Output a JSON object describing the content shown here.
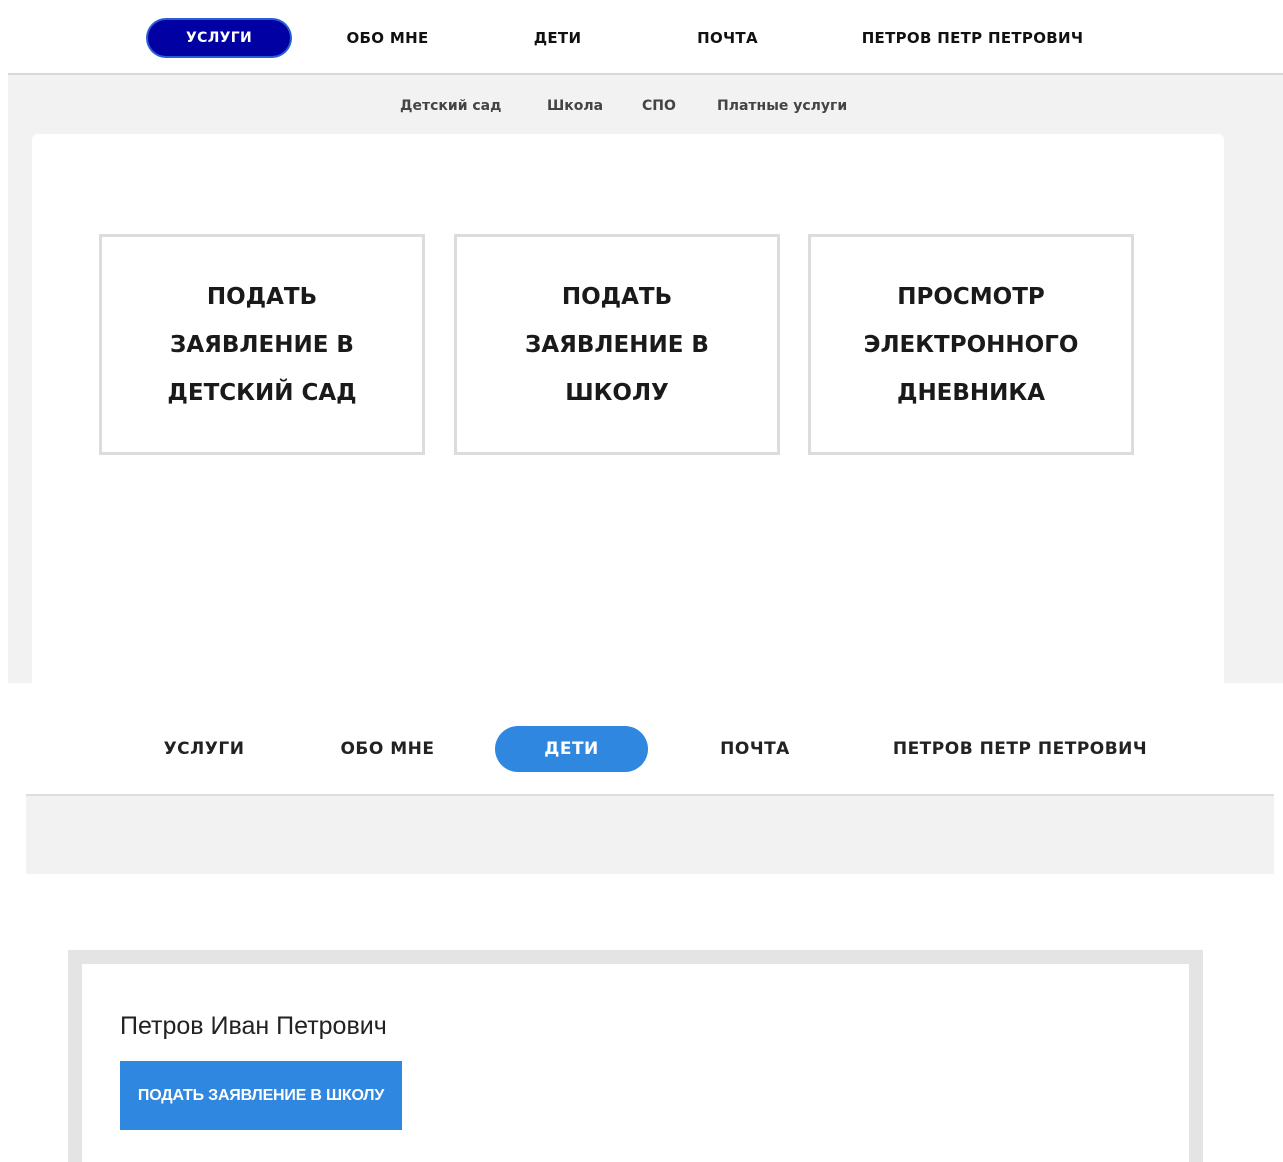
{
  "top": {
    "nav": {
      "services": "УСЛУГИ",
      "about": "ОБО МНЕ",
      "children": "ДЕТИ",
      "mail": "ПОЧТА",
      "user": "ПЕТРОВ ПЕТР ПЕТРОВИЧ",
      "active": "services"
    },
    "subnav": [
      "Детский сад",
      "Школа",
      "СПО",
      "Платные услуги"
    ],
    "cards": [
      "ПОДАТЬ ЗАЯВЛЕНИЕ В ДЕТСКИЙ САД",
      "ПОДАТЬ ЗАЯВЛЕНИЕ В ШКОЛУ",
      "ПРОСМОТР ЭЛЕКТРОННОГО ДНЕВНИКА"
    ]
  },
  "bottom": {
    "nav": {
      "services": "УСЛУГИ",
      "about": "ОБО МНЕ",
      "children": "ДЕТИ",
      "mail": "ПОЧТА",
      "user": "ПЕТРОВ ПЕТР ПЕТРОВИЧ",
      "active": "children"
    },
    "child": {
      "name": "Петров Иван Петрович",
      "button": "ПОДАТЬ ЗАЯВЛЕНИЕ В ШКОЛУ"
    }
  },
  "colors": {
    "active_top": "#0000a3",
    "active_bottom": "#2f87e0",
    "panel_bg": "#f2f2f2"
  }
}
